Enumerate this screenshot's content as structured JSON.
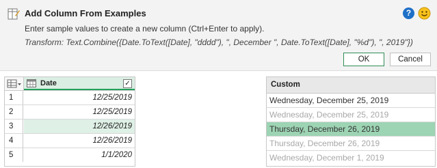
{
  "dialog": {
    "title": "Add Column From Examples",
    "subtitle": "Enter sample values to create a new column (Ctrl+Enter to apply).",
    "transform": "Transform: Text.Combine({Date.ToText([Date], \"dddd\"), \", December \", Date.ToText([Date], \"%d\"), \", 2019\"})",
    "help_icon": "question-circle",
    "smile_icon": "smiley-face",
    "ok_label": "OK",
    "cancel_label": "Cancel"
  },
  "grid": {
    "column_header": "Date",
    "rows": [
      {
        "num": "1",
        "date": "12/25/2019"
      },
      {
        "num": "2",
        "date": "12/25/2019"
      },
      {
        "num": "3",
        "date": "12/26/2019"
      },
      {
        "num": "4",
        "date": "12/26/2019"
      },
      {
        "num": "5",
        "date": "1/1/2020"
      }
    ]
  },
  "custom": {
    "header": "Custom",
    "rows": [
      "Wednesday, December 25, 2019",
      "Wednesday, December 25, 2019",
      "Thursday, December 26, 2019",
      "Thursday, December 26, 2019",
      "Wednesday, December 1, 2019"
    ]
  },
  "colors": {
    "accent": "#23a05a",
    "selected_row": "#9dd4b4",
    "help_blue": "#1e6fc7"
  }
}
